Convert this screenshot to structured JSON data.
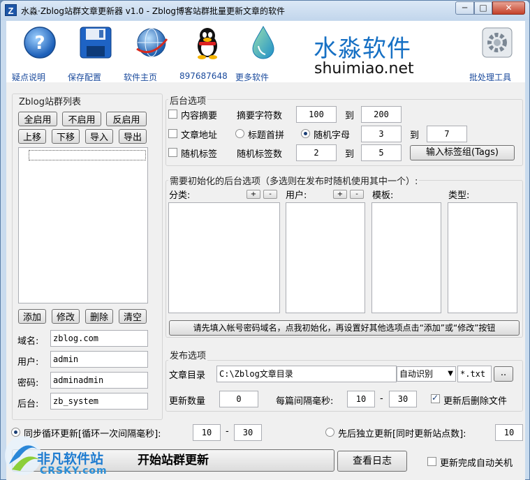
{
  "window": {
    "title": "水淼·Zblog站群文章更新器 v1.0 - Zblog博客站群批量更新文章的软件",
    "app_icon_letter": "Z",
    "min": "─",
    "max": "□",
    "close": "✕"
  },
  "toolbar": {
    "items": [
      {
        "label": "疑点说明",
        "icon": "help-icon"
      },
      {
        "label": "保存配置",
        "icon": "save-disk-icon"
      },
      {
        "label": "软件主页",
        "icon": "globe-icon"
      },
      {
        "label": "897687648",
        "icon": "qq-penguin-icon"
      },
      {
        "label": "更多软件",
        "icon": "water-drop-icon"
      }
    ],
    "brand_cn": "水淼软件",
    "brand_en": "shuimiao.net",
    "batch_label": "批处理工具"
  },
  "site_list": {
    "title": "Zblog站群列表",
    "buttons_row1": [
      "全启用",
      "不启用",
      "反启用"
    ],
    "buttons_row2": [
      "上移",
      "下移",
      "导入",
      "导出"
    ],
    "buttons_row3": [
      "添加",
      "修改",
      "删除",
      "清空"
    ],
    "domain_label": "域名:",
    "domain_value": "zblog.com",
    "user_label": "用户:",
    "user_value": "admin",
    "password_label": "密码:",
    "password_value": "adminadmin",
    "backend_label": "后台:",
    "backend_value": "zb_system"
  },
  "backend_options": {
    "title": "后台选项",
    "summary_cb": "内容摘要",
    "summary_len_label": "摘要字符数",
    "summary_min": "100",
    "to1": "到",
    "summary_max": "200",
    "address_cb": "文章地址",
    "radio_pinyin": "标题首拼",
    "radio_random": "随机字母",
    "letters_min": "3",
    "to2": "到",
    "letters_max": "7",
    "tags_cb": "随机标签",
    "tags_count_label": "随机标签数",
    "tags_min": "2",
    "to3": "到",
    "tags_max": "5",
    "tags_button": "输入标签组(Tags)"
  },
  "init_options": {
    "title": "需要初始化的后台选项（多选则在发布时随机使用其中一个）:",
    "category_label": "分类:",
    "user_label": "用户:",
    "template_label": "模板:",
    "type_label": "类型:",
    "plus": "+",
    "minus": "-",
    "init_button": "请先填入帐号密码域名，点我初始化，再设置好其他选项点击“添加”或“修改”按钮"
  },
  "publish": {
    "title": "发布选项",
    "dir_label": "文章目录",
    "dir_value": "C:\\Zblog文章目录",
    "encoding": "自动识别",
    "pattern": "*.txt",
    "browse": "..",
    "count_label": "更新数量",
    "count_value": "0",
    "interval_label": "每篇间隔毫秒:",
    "interval_min": "10",
    "dash": "-",
    "interval_max": "30",
    "delete_cb": "更新后删除文件"
  },
  "bottom": {
    "sync_radio": "同步循环更新[循环一次间隔毫秒]:",
    "sync_min": "10",
    "dash": "-",
    "sync_max": "30",
    "seq_radio": "先后独立更新[同时更新站点数]:",
    "seq_value": "10",
    "start_button": "开始站群更新",
    "log_button": "查看日志",
    "shutdown_cb": "更新完成自动关机"
  },
  "watermark": {
    "cn": "非凡软件站",
    "en": "CRSKY.com"
  }
}
